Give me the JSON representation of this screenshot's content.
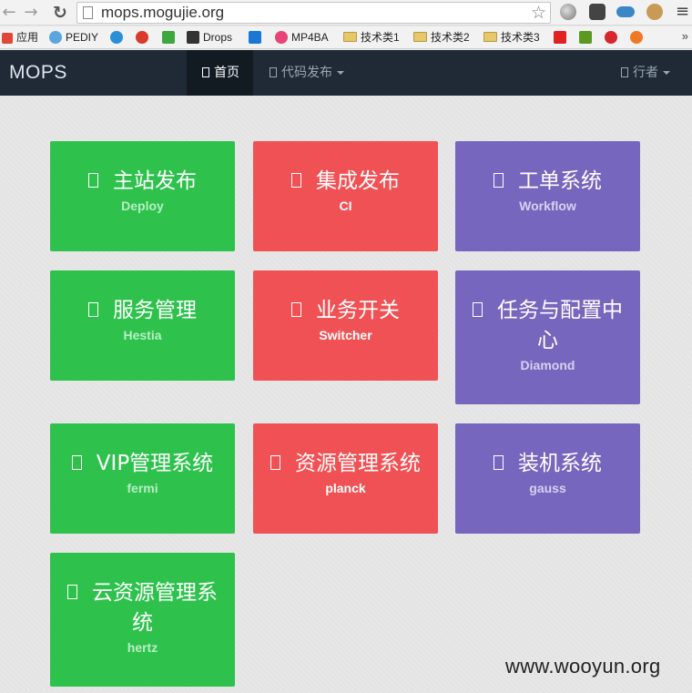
{
  "browser": {
    "url": "mops.mogujie.org",
    "bookmarks": [
      {
        "label": "应用",
        "color": "#e2463b"
      },
      {
        "label": "PEDIY",
        "color": "#5ba6e0"
      },
      {
        "label": "",
        "color": "#2a8fd6"
      },
      {
        "label": "",
        "color": "#d93a2b"
      },
      {
        "label": "",
        "color": "#3ea83e"
      },
      {
        "label": "Drops",
        "color": "#333333"
      },
      {
        "label": "",
        "color": "#1b77d3"
      },
      {
        "label": "MP4BA",
        "color": "#e8447a"
      },
      {
        "label": "技术类1",
        "color": "folder"
      },
      {
        "label": "技术类2",
        "color": "folder"
      },
      {
        "label": "技术类3",
        "color": "folder"
      },
      {
        "label": "",
        "color": "#e02222"
      },
      {
        "label": "",
        "color": "#5a9a1e"
      },
      {
        "label": "",
        "color": "#d9262c"
      },
      {
        "label": "",
        "color": "#f07a23"
      }
    ],
    "more": "»"
  },
  "navbar": {
    "brand": "MOPS",
    "home": "首页",
    "deploy": "代码发布",
    "user": "行者"
  },
  "tiles": [
    {
      "title": "主站发布",
      "sub": "Deploy",
      "color": "green"
    },
    {
      "title": "集成发布",
      "sub": "CI",
      "color": "red"
    },
    {
      "title": "工单系统",
      "sub": "Workflow",
      "color": "purple"
    },
    {
      "title": "服务管理",
      "sub": "Hestia",
      "color": "green"
    },
    {
      "title": "业务开关",
      "sub": "Switcher",
      "color": "red"
    },
    {
      "title": "任务与配置中心",
      "sub": "Diamond",
      "color": "purple"
    },
    {
      "title": "VIP管理系统",
      "sub": "fermi",
      "color": "green"
    },
    {
      "title": "资源管理系统",
      "sub": "planck",
      "color": "red"
    },
    {
      "title": "装机系统",
      "sub": "gauss",
      "color": "purple"
    },
    {
      "title": "云资源管理系统",
      "sub": "hertz",
      "color": "green"
    }
  ],
  "watermark": "www.wooyun.org"
}
